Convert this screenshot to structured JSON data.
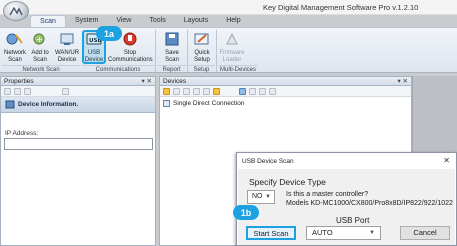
{
  "window": {
    "title": "Key Digital Management Software Pro  v.1.2.10"
  },
  "ribbon": {
    "tabs": [
      "Scan",
      "System",
      "View",
      "Tools",
      "Layouts",
      "Help"
    ],
    "buttons": {
      "network_scan": "Network Scan",
      "add_to_scan": "Add to Scan",
      "wan_device": "WAN/UR Device",
      "usb_device": "USB Device",
      "stop_comms": "Stop Communications",
      "save_scan": "Save Scan",
      "quick_setup": "Quick Setup",
      "firmware_loader": "Firmware Loader"
    },
    "groups": {
      "network_scan": "Network Scan",
      "communications": "Communications",
      "report": "Report",
      "setup": "Setup",
      "multi_devices": "Multi-Devices"
    }
  },
  "steps": {
    "a": "1a",
    "b": "1b"
  },
  "properties": {
    "title": "Properties",
    "pin": "▾ ✕",
    "device_info": "Device Information.",
    "ip_label": "IP Address:",
    "ip_value": ""
  },
  "devices": {
    "title": "Devices",
    "pin": "▾ ✕",
    "tree_item": "Single Direct Connection"
  },
  "dialog": {
    "title": "USB Device Scan",
    "close": "✕",
    "type_label": "Specify Device Type",
    "master_value": "NO",
    "question_line1": "Is this a master controller?",
    "question_line2": "Models KD-MC1000/CX800/Pro8x8D/IP822/922/1022",
    "port_label": "USB Port",
    "port_value": "AUTO",
    "start_scan": "Start Scan",
    "cancel": "Cancel"
  },
  "colors": {
    "highlight": "#1da1e0"
  }
}
